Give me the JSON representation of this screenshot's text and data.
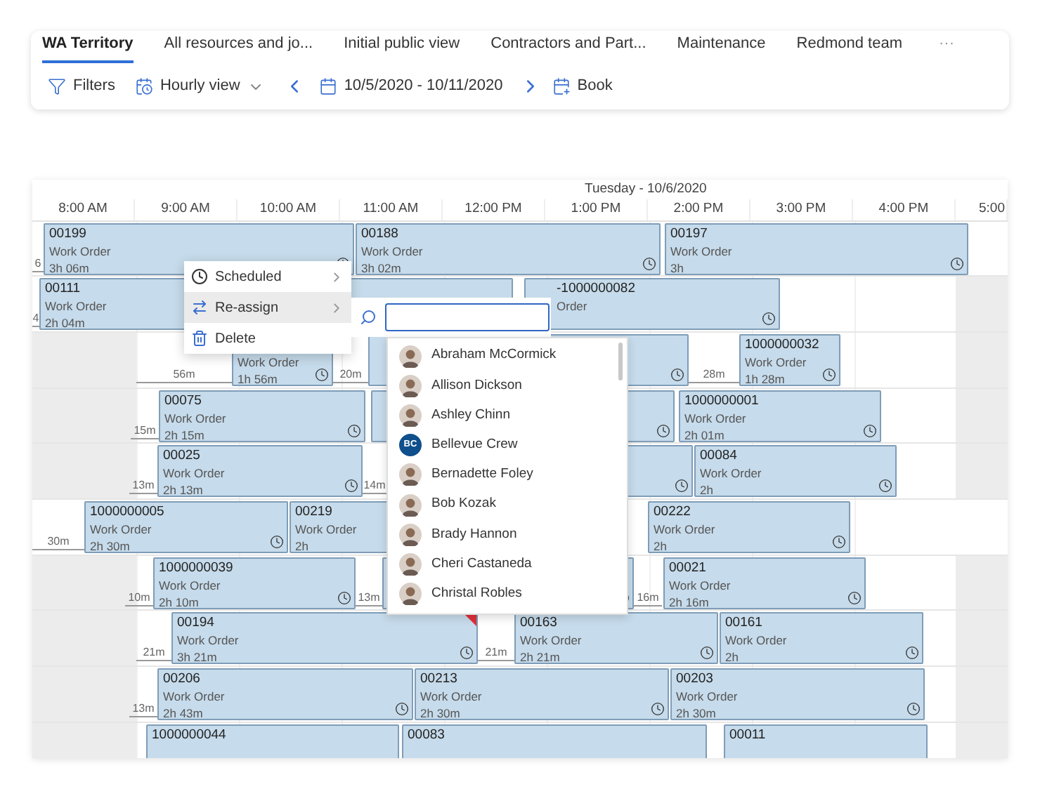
{
  "tabs": [
    {
      "label": "WA Territory",
      "selected": true
    },
    {
      "label": "All resources and jo...",
      "selected": false
    },
    {
      "label": "Initial public view",
      "selected": false
    },
    {
      "label": "Contractors and Part...",
      "selected": false
    },
    {
      "label": "Maintenance",
      "selected": false
    },
    {
      "label": "Redmond team",
      "selected": false
    }
  ],
  "more": "···",
  "toolbar": {
    "filters": "Filters",
    "view": "Hourly view",
    "date_range": "10/5/2020 - 10/11/2020",
    "book": "Book"
  },
  "board": {
    "day": "Tuesday - 10/6/2020",
    "hours": [
      "8:00 AM",
      "9:00 AM",
      "10:00 AM",
      "11:00 AM",
      "12:00 PM",
      "1:00 PM",
      "2:00 PM",
      "3:00 PM",
      "4:00 PM",
      "5:00"
    ],
    "rows": [
      {
        "items": [
          {
            "kind": "gap",
            "label": "6"
          },
          {
            "kind": "booking",
            "title": "00199",
            "type": "Work Order",
            "duration": "3h 06m"
          },
          {
            "kind": "booking",
            "title": "00188",
            "type": "Work Order",
            "duration": "3h 02m"
          },
          {
            "kind": "booking",
            "title": "00197",
            "type": "Work Order",
            "duration": "3h"
          }
        ]
      },
      {
        "items": [
          {
            "kind": "gap",
            "label": "4"
          },
          {
            "kind": "booking",
            "title": "00111",
            "type": "Work Order",
            "duration": "2h 04m"
          },
          {
            "kind": "booking",
            "title": "-1000000082",
            "type": "Order"
          }
        ]
      },
      {
        "items": [
          {
            "kind": "gap",
            "label": "56m"
          },
          {
            "kind": "booking",
            "type": "Work Order",
            "duration": "1h 56m"
          },
          {
            "kind": "gap",
            "label": "20m"
          },
          {
            "kind": "booking"
          },
          {
            "kind": "gap",
            "label": "28m"
          },
          {
            "kind": "booking",
            "title": "1000000032",
            "type": "Work Order",
            "duration": "1h 28m"
          }
        ]
      },
      {
        "items": [
          {
            "kind": "gap",
            "label": "15m"
          },
          {
            "kind": "booking",
            "title": "00075",
            "type": "Work Order",
            "duration": "2h 15m"
          },
          {
            "kind": "booking"
          },
          {
            "kind": "booking",
            "title": "1000000001",
            "type": "Work Order",
            "duration": "2h 01m"
          }
        ]
      },
      {
        "items": [
          {
            "kind": "gap",
            "label": "13m"
          },
          {
            "kind": "booking",
            "title": "00025",
            "type": "Work Order",
            "duration": "2h 13m"
          },
          {
            "kind": "gap",
            "label": "14m"
          },
          {
            "kind": "booking"
          },
          {
            "kind": "booking",
            "title": "00084",
            "type": "Work Order",
            "duration": "2h"
          }
        ]
      },
      {
        "items": [
          {
            "kind": "gap",
            "label": "30m"
          },
          {
            "kind": "booking",
            "title": "1000000005",
            "type": "Work Order",
            "duration": "2h 30m"
          },
          {
            "kind": "booking",
            "title": "00219",
            "type": "Work Order",
            "duration": "2h"
          },
          {
            "kind": "booking",
            "title": "00222",
            "type": "Work Order",
            "duration": "2h"
          }
        ]
      },
      {
        "items": [
          {
            "kind": "gap",
            "label": "10m"
          },
          {
            "kind": "booking",
            "title": "1000000039",
            "type": "Work Order",
            "duration": "2h 10m"
          },
          {
            "kind": "gap",
            "label": "13m"
          },
          {
            "kind": "booking"
          },
          {
            "kind": "gap",
            "label": "16m"
          },
          {
            "kind": "booking",
            "title": "00021",
            "type": "Work Order",
            "duration": "2h 16m"
          }
        ]
      },
      {
        "items": [
          {
            "kind": "gap",
            "label": "21m"
          },
          {
            "kind": "booking",
            "title": "00194",
            "type": "Work Order",
            "duration": "3h 21m",
            "alert": true
          },
          {
            "kind": "gap",
            "label": "21m"
          },
          {
            "kind": "booking",
            "title": "00163",
            "type": "Work Order",
            "duration": "2h 21m"
          },
          {
            "kind": "booking",
            "title": "00161",
            "type": "Work Order",
            "duration": "2h"
          }
        ]
      },
      {
        "items": [
          {
            "kind": "gap",
            "label": "13m"
          },
          {
            "kind": "booking",
            "title": "00206",
            "type": "Work Order",
            "duration": "2h 43m"
          },
          {
            "kind": "booking",
            "title": "00213",
            "type": "Work Order",
            "duration": "2h 30m"
          },
          {
            "kind": "booking",
            "title": "00203",
            "type": "Work Order",
            "duration": "2h 30m"
          }
        ]
      },
      {
        "items": [
          {
            "kind": "booking",
            "title": "1000000044"
          },
          {
            "kind": "booking",
            "title": "00083"
          },
          {
            "kind": "booking",
            "title": "00011"
          }
        ]
      }
    ]
  },
  "context_menu": [
    {
      "kind": "scheduled",
      "label": "Scheduled",
      "submenu": true,
      "selected": false
    },
    {
      "kind": "reassign",
      "label": "Re-assign",
      "submenu": true,
      "selected": true
    },
    {
      "kind": "delete",
      "label": "Delete",
      "submenu": false,
      "selected": false
    }
  ],
  "reassign": {
    "people": [
      {
        "name": "Abraham McCormick",
        "kind": "photo"
      },
      {
        "name": "Allison Dickson",
        "kind": "photo"
      },
      {
        "name": "Ashley Chinn",
        "kind": "photo"
      },
      {
        "name": "Bellevue Crew",
        "kind": "initials",
        "initials": "BC"
      },
      {
        "name": "Bernadette Foley",
        "kind": "photo"
      },
      {
        "name": "Bob Kozak",
        "kind": "photo"
      },
      {
        "name": "Brady Hannon",
        "kind": "photo"
      },
      {
        "name": "Cheri Castaneda",
        "kind": "photo"
      },
      {
        "name": "Christal Robles",
        "kind": "photo"
      }
    ]
  }
}
